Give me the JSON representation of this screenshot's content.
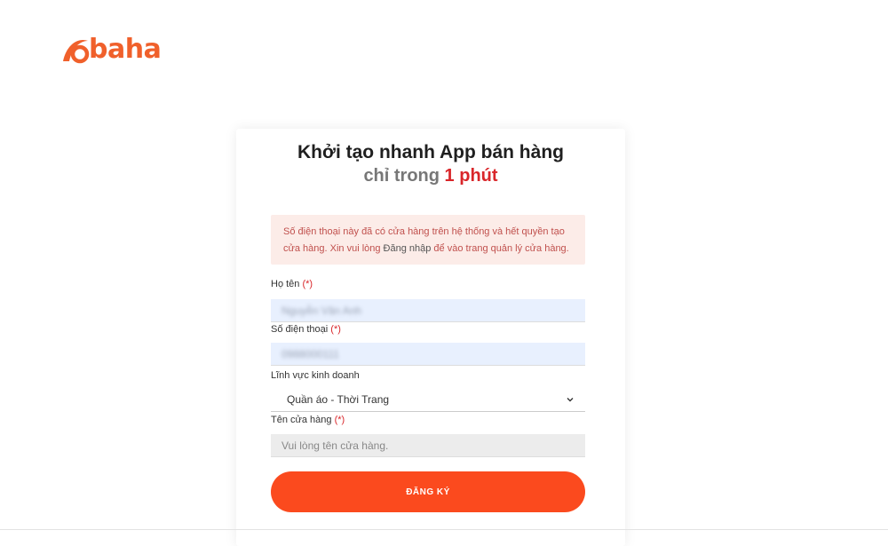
{
  "brand": {
    "name": "baha",
    "color": "#f0602b"
  },
  "heading": {
    "line1": "Khởi tạo nhanh App bán hàng",
    "line2_prefix": "chỉ trong ",
    "line2_highlight": "1 phút"
  },
  "alert": {
    "text_before": "Số điện thoại này đã có cửa hàng trên hệ thống và hết quyền tạo cửa hàng. Xin vui lòng ",
    "link_label": "Đăng nhập",
    "text_after": " để vào trang quản lý cửa hàng."
  },
  "form": {
    "required_mark": "(*)",
    "full_name": {
      "label": "Họ tên ",
      "value": "Nguyễn Văn Anh"
    },
    "phone": {
      "label": "Số điện thoại ",
      "value": "0988000111"
    },
    "business": {
      "label": "Lĩnh vực kinh doanh",
      "selected": "Quần áo - Thời Trang"
    },
    "store_name": {
      "label": "Tên cửa hàng ",
      "placeholder": "Vui lòng tên cửa hàng."
    },
    "submit_label": "ĐĂNG KÝ"
  },
  "colors": {
    "accent": "#fb4a1e",
    "required": "#d9262a",
    "alert_bg": "#fcece8",
    "alert_text": "#c0504d"
  }
}
